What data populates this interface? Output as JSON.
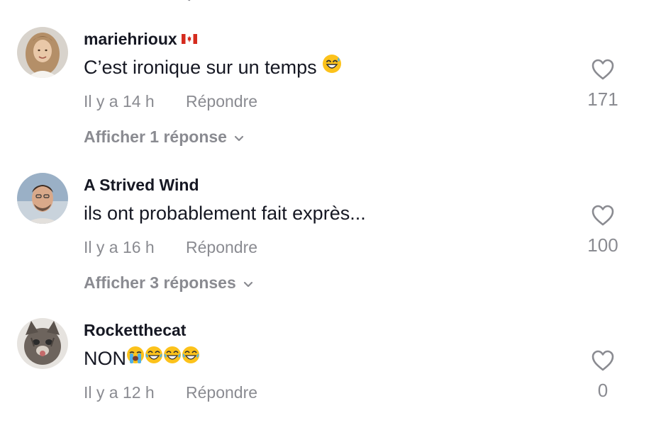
{
  "comments": [
    {
      "username": "mariehrioux",
      "flag": "canada-flag-icon",
      "text": "C’est ironique sur un temps",
      "emojis": [
        "sweat-smile-emoji"
      ],
      "time": "Il y a 14 h",
      "reply_label": "Répondre",
      "likes": "171",
      "view_replies": "Afficher 1 réponse"
    },
    {
      "username": "A Strived Wind",
      "text": "ils ont probablement fait exprès...",
      "emojis": [],
      "time": "Il y a 16 h",
      "reply_label": "Répondre",
      "likes": "100",
      "view_replies": "Afficher 3 réponses"
    },
    {
      "username": "Rocketthecat",
      "text": "NON",
      "emojis": [
        "loudly-crying-emoji",
        "tears-of-joy-emoji",
        "tears-of-joy-emoji",
        "tears-of-joy-emoji"
      ],
      "time": "Il y a 12 h",
      "reply_label": "Répondre",
      "likes": "0"
    }
  ],
  "icons": {
    "like": "heart-outline-icon",
    "expand": "chevron-down-icon"
  },
  "colors": {
    "primary_text": "#161823",
    "secondary_text": "#8a8b91",
    "background": "#ffffff"
  }
}
